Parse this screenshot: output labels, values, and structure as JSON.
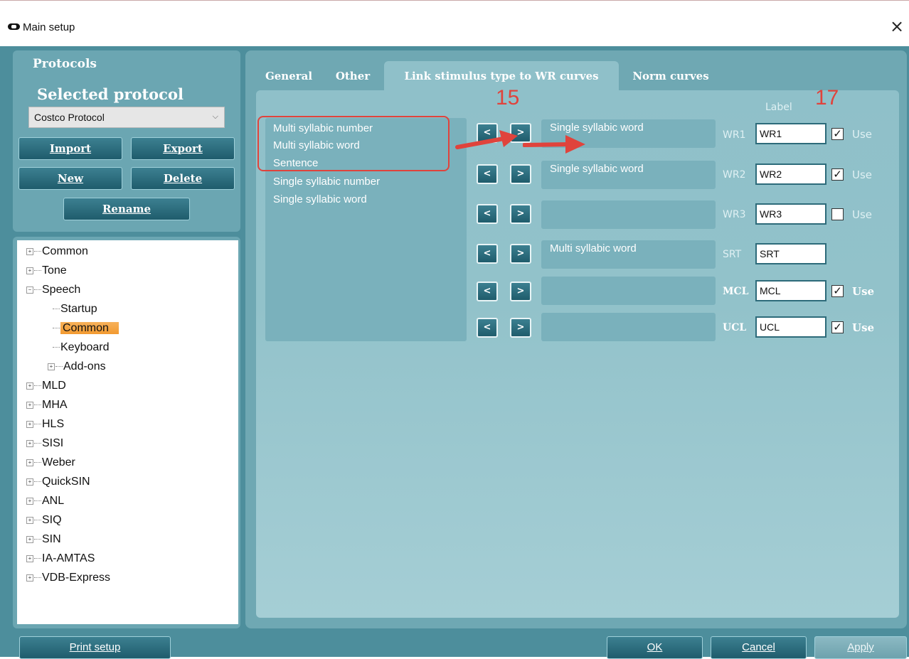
{
  "window": {
    "title": "Main setup",
    "icon": "hearing-device-icon",
    "close_glyph": "×"
  },
  "left": {
    "protocols_header": "Protocols",
    "selected_protocol_header": "Selected protocol",
    "protocol_dropdown": {
      "value": "Costco Protocol"
    },
    "buttons": {
      "import": "Import",
      "export": "Export",
      "new": "New",
      "delete": "Delete",
      "rename": "Rename"
    }
  },
  "tree": {
    "items": [
      {
        "label": "Common",
        "expander": "+"
      },
      {
        "label": "Tone",
        "expander": "+"
      },
      {
        "label": "Speech",
        "expander": "−"
      },
      {
        "label": "Startup"
      },
      {
        "label": "Common",
        "selected": true
      },
      {
        "label": "Keyboard"
      },
      {
        "label": "Add-ons",
        "expander": "+"
      },
      {
        "label": "MLD",
        "expander": "+"
      },
      {
        "label": "MHA",
        "expander": "+"
      },
      {
        "label": "HLS",
        "expander": "+"
      },
      {
        "label": "SISI",
        "expander": "+"
      },
      {
        "label": "Weber",
        "expander": "+"
      },
      {
        "label": "QuickSIN",
        "expander": "+"
      },
      {
        "label": "ANL",
        "expander": "+"
      },
      {
        "label": "SIQ",
        "expander": "+"
      },
      {
        "label": "SIN",
        "expander": "+"
      },
      {
        "label": "IA-AMTAS",
        "expander": "+"
      },
      {
        "label": "VDB-Express",
        "expander": "+"
      }
    ]
  },
  "tabs": [
    {
      "label": "General"
    },
    {
      "label": "Other"
    },
    {
      "label": "Link stimulus type to WR curves",
      "active": true
    },
    {
      "label": "Norm curves"
    }
  ],
  "stimulus_list": [
    "Multi syllabic number",
    "Multi syllabic word",
    "Sentence",
    "Single syllabic number",
    "Single syllabic word"
  ],
  "label_header": "Label",
  "curves": [
    {
      "tag": "WR1",
      "assigned": "Single syllabic word",
      "label": "WR1",
      "checked": true,
      "use": "Use",
      "bold": false
    },
    {
      "tag": "WR2",
      "assigned": "Single syllabic word",
      "label": "WR2",
      "checked": true,
      "use": "Use",
      "bold": false
    },
    {
      "tag": "WR3",
      "assigned": "",
      "label": "WR3",
      "checked": false,
      "use": "Use",
      "bold": false
    },
    {
      "tag": "SRT",
      "assigned": "Multi syllabic word",
      "label": "SRT",
      "checked": null,
      "use": "",
      "bold": false
    },
    {
      "tag": "MCL",
      "assigned": "",
      "label": "MCL",
      "checked": true,
      "use": "Use",
      "bold": true
    },
    {
      "tag": "UCL",
      "assigned": "",
      "label": "UCL",
      "checked": true,
      "use": "Use",
      "bold": true
    }
  ],
  "arrow_labels": {
    "left": "<",
    "right": ">"
  },
  "annotations": {
    "step_15": "15",
    "step_17": "17",
    "color": "#e0433c"
  },
  "bottom": {
    "print_setup": "Print setup",
    "ok": "OK",
    "cancel": "Cancel",
    "apply": "Apply"
  },
  "colors": {
    "frame": "#4d8e9c",
    "panel": "#6fa8b3",
    "button": "#1f5c6c",
    "selected_node": "#f29a30"
  }
}
